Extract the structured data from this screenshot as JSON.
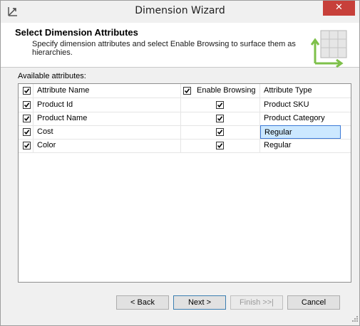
{
  "window": {
    "title": "Dimension Wizard",
    "close_glyph": "✕"
  },
  "header": {
    "title": "Select Dimension Attributes",
    "description": "Specify dimension attributes and select Enable Browsing to surface them as hierarchies."
  },
  "grid": {
    "label": "Available attributes:",
    "columns": {
      "name": "Attribute Name",
      "browsing": "Enable Browsing",
      "type": "Attribute Type"
    },
    "rows": [
      {
        "name": "Product Id",
        "type": "Product SKU",
        "included": true,
        "browsing": true
      },
      {
        "name": "Product Name",
        "type": "Product Category",
        "included": true,
        "browsing": true
      },
      {
        "name": "Cost",
        "type": "Regular",
        "included": true,
        "browsing": true
      },
      {
        "name": "Color",
        "type": "Regular",
        "included": true,
        "browsing": true
      }
    ]
  },
  "buttons": {
    "back": "< Back",
    "next": "Next >",
    "finish": "Finish >>|",
    "cancel": "Cancel"
  },
  "colors": {
    "close_button": "#c7403a",
    "selection": "#cce8ff",
    "accent_green": "#7ec04a"
  }
}
